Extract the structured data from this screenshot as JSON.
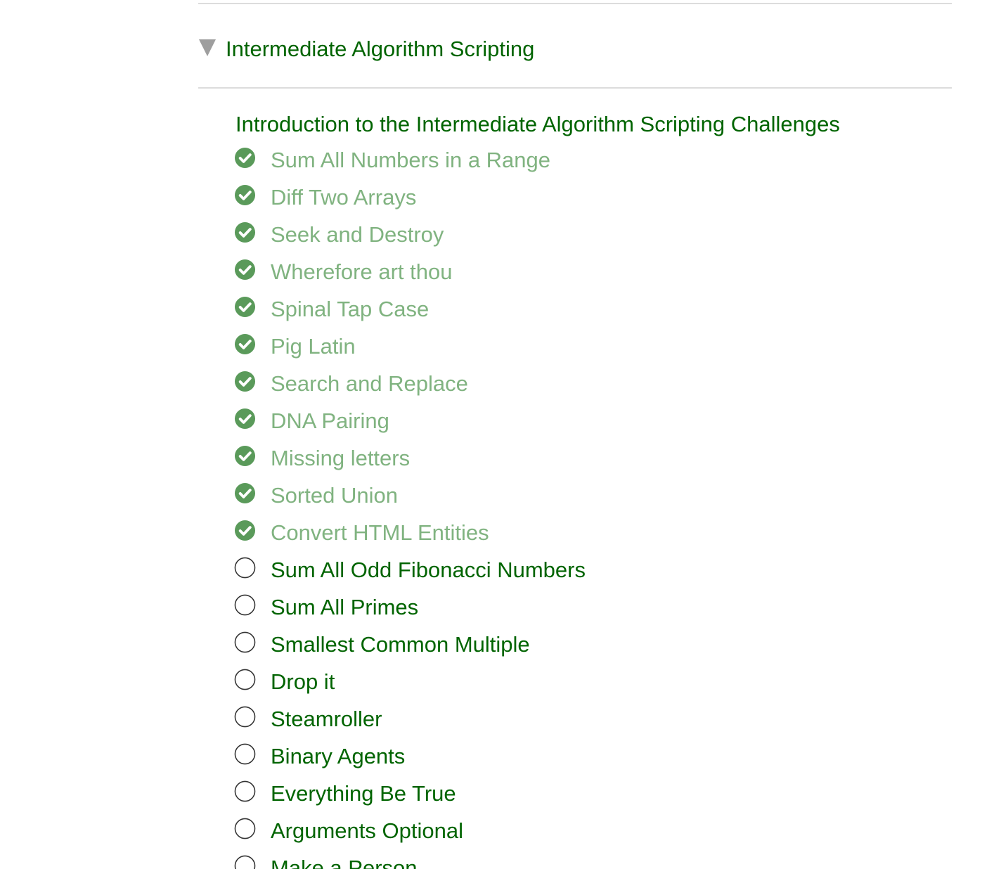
{
  "section": {
    "title": "Intermediate Algorithm Scripting",
    "expanded": true,
    "caret_icon": "triangle-down-icon"
  },
  "intro_link": "Introduction to the Intermediate Algorithm Scripting Challenges",
  "colors": {
    "link": "#006400",
    "completed": "#80b380",
    "check_fill": "#5a9a5a",
    "divider": "#dcdcdc",
    "caret": "#9e9e9e"
  },
  "challenges": [
    {
      "label": "Sum All Numbers in a Range",
      "completed": true
    },
    {
      "label": "Diff Two Arrays",
      "completed": true
    },
    {
      "label": "Seek and Destroy",
      "completed": true
    },
    {
      "label": "Wherefore art thou",
      "completed": true
    },
    {
      "label": "Spinal Tap Case",
      "completed": true
    },
    {
      "label": "Pig Latin",
      "completed": true
    },
    {
      "label": "Search and Replace",
      "completed": true
    },
    {
      "label": "DNA Pairing",
      "completed": true
    },
    {
      "label": "Missing letters",
      "completed": true
    },
    {
      "label": "Sorted Union",
      "completed": true
    },
    {
      "label": "Convert HTML Entities",
      "completed": true
    },
    {
      "label": "Sum All Odd Fibonacci Numbers",
      "completed": false
    },
    {
      "label": "Sum All Primes",
      "completed": false
    },
    {
      "label": "Smallest Common Multiple",
      "completed": false
    },
    {
      "label": "Drop it",
      "completed": false
    },
    {
      "label": "Steamroller",
      "completed": false
    },
    {
      "label": "Binary Agents",
      "completed": false
    },
    {
      "label": "Everything Be True",
      "completed": false
    },
    {
      "label": "Arguments Optional",
      "completed": false
    },
    {
      "label": "Make a Person",
      "completed": false
    }
  ]
}
